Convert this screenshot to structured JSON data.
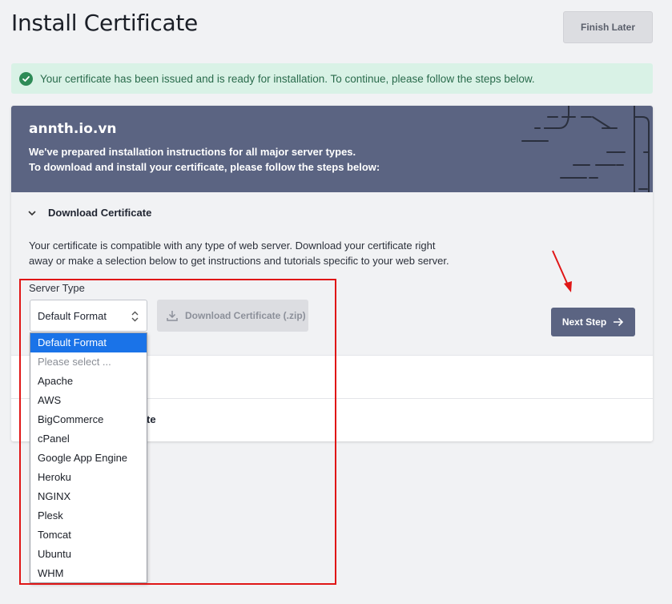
{
  "page": {
    "title": "Install Certificate",
    "finish_label": "Finish Later"
  },
  "alert": {
    "message": "Your certificate has been issued and is ready for installation. To continue, please follow the steps below.",
    "color": "#2e8b57"
  },
  "card": {
    "domain": "annth.io.vn",
    "line1": "We've prepared installation instructions for all major server types.",
    "line2": "To download and install your certificate, please follow the steps below:",
    "header_color": "#5b6482"
  },
  "download_section": {
    "title": "Download Certificate",
    "description": "Your certificate is compatible with any type of web server. Download your certificate right away or make a selection below to get instructions and tutorials specific to your web server.",
    "server_type_label": "Server Type",
    "selected_value": "Default Format",
    "download_button": "Download Certificate (.zip)",
    "next_button": "Next Step"
  },
  "rows": {
    "row2_visible_text": "te"
  },
  "dropdown": {
    "options": [
      "Default Format",
      "Please select ...",
      "Apache",
      "AWS",
      "BigCommerce",
      "cPanel",
      "Google App Engine",
      "Heroku",
      "NGINX",
      "Plesk",
      "Tomcat",
      "Ubuntu",
      "WHM"
    ],
    "selected_index": 0,
    "highlight_color": "#1a73e8"
  },
  "icons": {
    "alert": "check-circle-icon",
    "toggle": "chevron-down-icon",
    "select": "select-arrows-icon",
    "download": "download-icon",
    "next": "arrow-right-icon"
  },
  "annotation_color": "#e01616"
}
